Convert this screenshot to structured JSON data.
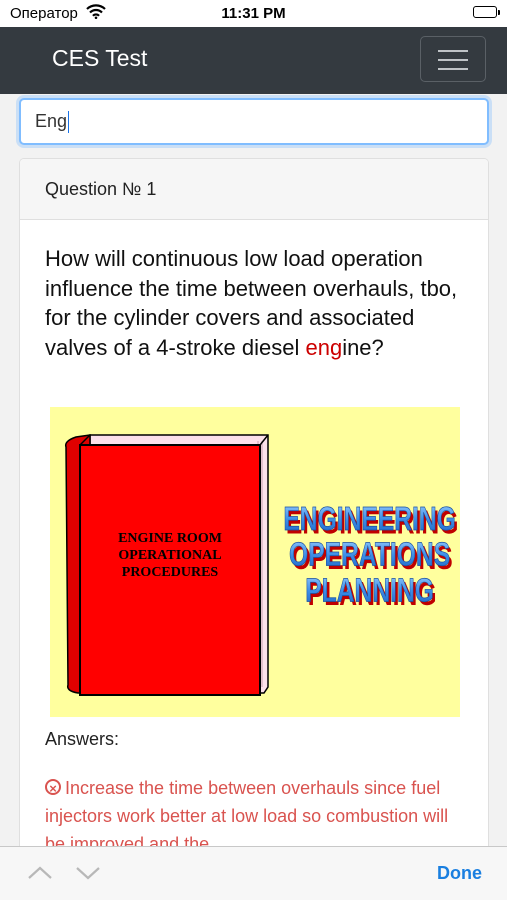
{
  "status_bar": {
    "carrier": "Оператор",
    "time": "11:31 PM"
  },
  "navbar": {
    "brand": "CES Test"
  },
  "search": {
    "value": "Eng"
  },
  "question_card": {
    "header": "Question № 1",
    "question_before": "How will continuous low load operation influence the time between overhauls, tbo, for the cylinder covers and associated valves of a 4-stroke diesel ",
    "question_highlight": "eng",
    "question_after": "ine?",
    "image": {
      "book_title_lines": [
        "ENGINE ROOM",
        "OPERATIONAL",
        "PROCEDURES"
      ],
      "banner_lines": [
        "ENGINEERING",
        "OPERATIONS",
        "PLANNING"
      ],
      "background_color": "#ffff9e",
      "book_color": "#ff0000"
    },
    "answers_label": "Answers:",
    "answers": [
      {
        "text": "Increase the time between overhauls since fuel injectors work better at low load so combustion will be improved and the",
        "status": "incorrect",
        "icon": "x-circle-icon"
      }
    ]
  },
  "keyboard_toolbar": {
    "done_label": "Done"
  },
  "colors": {
    "navbar": "#343a40",
    "incorrect": "#d9534f",
    "highlight": "#cc0000",
    "link": "#1a7fe0"
  }
}
